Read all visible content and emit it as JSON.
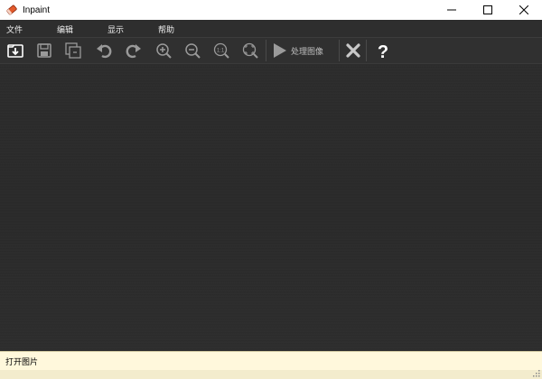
{
  "window": {
    "title": "Inpaint"
  },
  "menu": {
    "items": [
      "文件",
      "编辑",
      "显示",
      "帮助"
    ]
  },
  "toolbar": {
    "icons": [
      "open-image-icon",
      "save-icon",
      "save-as-icon",
      "undo-icon",
      "redo-icon",
      "zoom-in-icon",
      "zoom-out-icon",
      "zoom-1to1-icon",
      "fit-window-icon",
      "play-icon",
      "close-x-icon",
      "help-icon"
    ],
    "process_label": "处理图像",
    "zoom_1to1_text": "1:1",
    "help_text": "?"
  },
  "status": {
    "text": "打开图片"
  },
  "colors": {
    "canvas": "#2b2b2b",
    "toolbar": "#303030",
    "status_bg": "#fff8dc",
    "app_icon": "#e35a2b"
  }
}
